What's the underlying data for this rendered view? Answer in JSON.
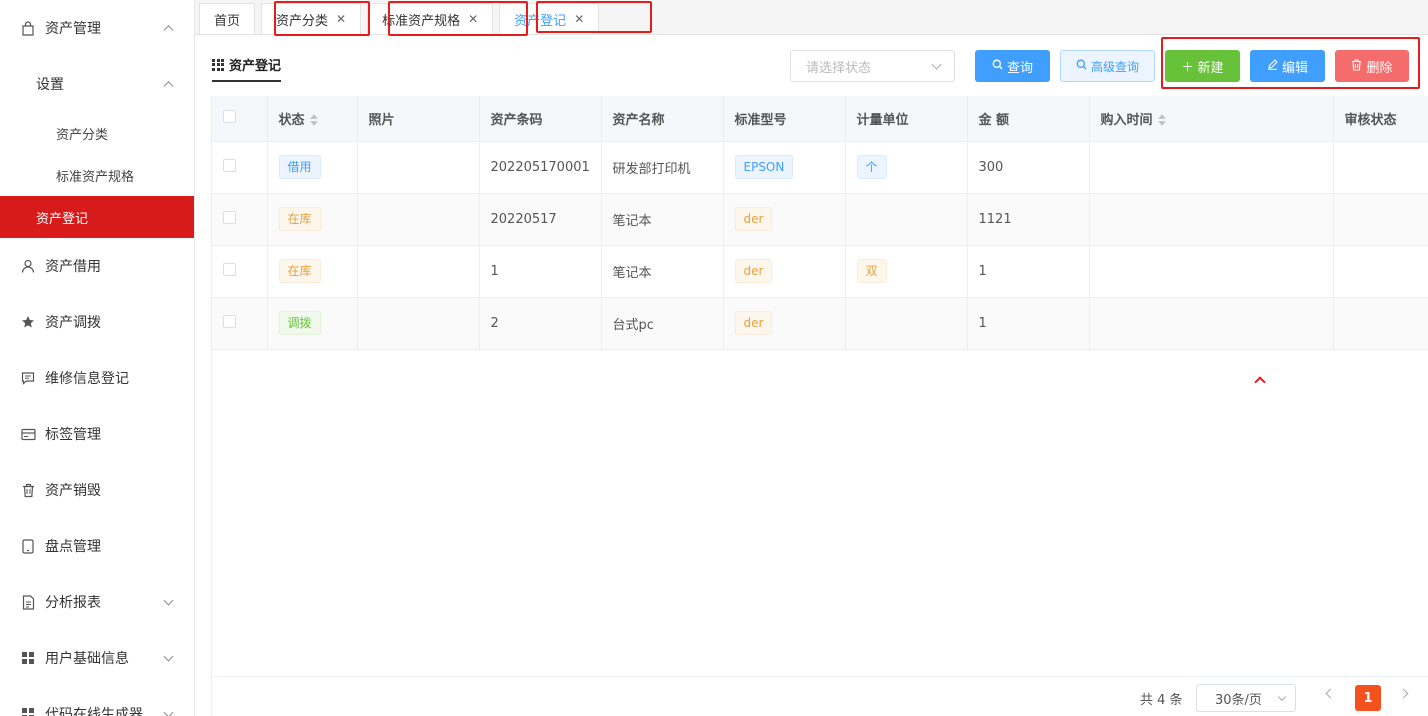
{
  "sidebar": {
    "asset_mgmt": {
      "label": "资产管理",
      "icon": "bag-icon"
    },
    "settings": {
      "label": "设置"
    },
    "settings_items": [
      "资产分类",
      "标准资产规格"
    ],
    "active_item": "资产登记",
    "items": [
      {
        "label": "资产借用",
        "icon": "user-icon"
      },
      {
        "label": "资产调拨",
        "icon": "star-icon"
      },
      {
        "label": "维修信息登记",
        "icon": "chat-icon"
      },
      {
        "label": "标签管理",
        "icon": "card-icon"
      },
      {
        "label": "资产销毁",
        "icon": "trash-icon"
      },
      {
        "label": "盘点管理",
        "icon": "tablet-icon"
      },
      {
        "label": "分析报表",
        "icon": "document-icon"
      },
      {
        "label": "用户基础信息",
        "icon": "grid-icon"
      },
      {
        "label": "代码在线生成器",
        "icon": "grid-icon"
      }
    ]
  },
  "tabs": [
    {
      "label": "首页"
    },
    {
      "label": "资产分类"
    },
    {
      "label": "标准资产规格"
    },
    {
      "label": "资产登记"
    }
  ],
  "toolbar": {
    "page_title": "资产登记",
    "status_placeholder": "请选择状态",
    "query_label": "查询",
    "adv_query_label": "高级查询",
    "new_label": "新建",
    "edit_label": "编辑",
    "delete_label": "删除"
  },
  "table": {
    "headers": [
      "状态",
      "照片",
      "资产条码",
      "资产名称",
      "标准型号",
      "计量单位",
      "金 额",
      "购入时间",
      "审核状态"
    ],
    "rows": [
      {
        "status": "借用",
        "barcode": "202205170001",
        "name": "研发部打印机",
        "model": "EPSON",
        "unit": "个",
        "amount": "300"
      },
      {
        "status": "在库",
        "barcode": "20220517",
        "name": "笔记本",
        "model": "der",
        "unit": "",
        "amount": "1121"
      },
      {
        "status": "在库",
        "barcode": "1",
        "name": "笔记本",
        "model": "der",
        "unit": "双",
        "amount": "1"
      },
      {
        "status": "调拨",
        "barcode": "2",
        "name": "台式pc",
        "model": "der",
        "unit": "",
        "amount": "1"
      }
    ]
  },
  "pager": {
    "total": "共 4 条",
    "page_size": "30条/页",
    "current_page": "1"
  },
  "colors": {
    "active_menu": "#d71a1a",
    "primary": "#409eff",
    "success": "#67c23a",
    "danger": "#f56c6c",
    "highlight_box": "#e51c1c"
  }
}
